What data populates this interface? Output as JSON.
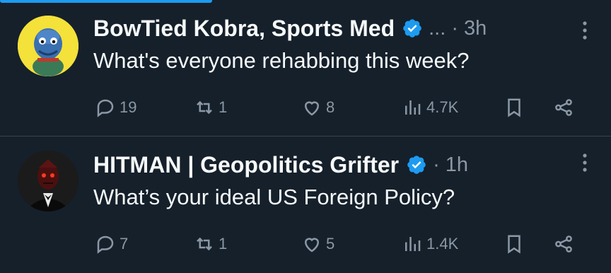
{
  "colors": {
    "background": "#15202b",
    "text": "#f7f9f9",
    "muted": "#8b98a5",
    "verified": "#1d9bf0",
    "divider": "#38444d",
    "accent": "#1d9bf0"
  },
  "tweets": [
    {
      "author": "BowTied Kobra, Sports Med",
      "verified": true,
      "meta": "... · 3h",
      "text": "What's everyone rehabbing this week?",
      "replies": "19",
      "reposts": "1",
      "likes": "8",
      "views": "4.7K"
    },
    {
      "author": "HITMAN | Geopolitics Grifter",
      "verified": true,
      "meta": "· 1h",
      "text": "What’s your ideal US Foreign Policy?",
      "replies": "7",
      "reposts": "1",
      "likes": "5",
      "views": "1.4K"
    }
  ]
}
